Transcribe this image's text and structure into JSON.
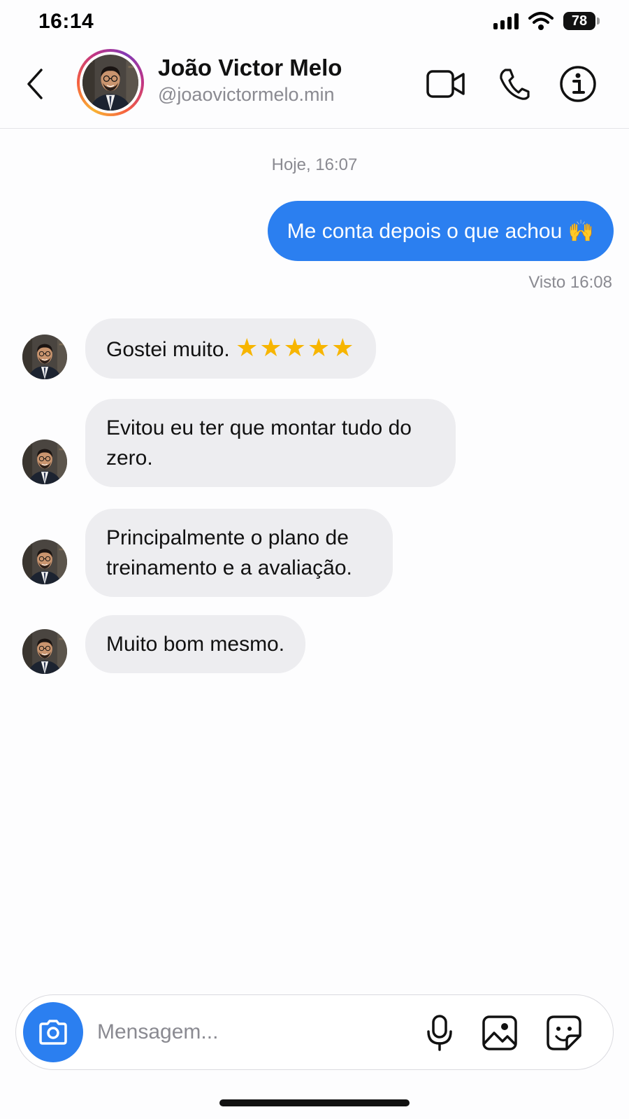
{
  "status_bar": {
    "time": "16:14",
    "battery": "78"
  },
  "header": {
    "contact_name": "João Victor Melo",
    "contact_handle": "@joaovictormelo.min",
    "icons": [
      "back-icon",
      "video-call-icon",
      "phone-icon",
      "info-icon"
    ]
  },
  "conversation": {
    "timestamp": "Hoje, 16:07",
    "outgoing": {
      "text": "Me conta depois o que achou 🙌"
    },
    "seen": "Visto 16:08",
    "incoming": [
      {
        "text": "Gostei muito.",
        "stars": "★★★★★"
      },
      {
        "text": "Evitou eu ter que montar tudo do zero."
      },
      {
        "text": "Principalmente o plano de treinamento e a avaliação."
      },
      {
        "text": "Muito bom mesmo."
      }
    ]
  },
  "composer": {
    "placeholder": "Mensagem...",
    "icons": [
      "camera-icon",
      "microphone-icon",
      "gallery-icon",
      "sticker-icon"
    ]
  },
  "colors": {
    "accent": "#2b7ff0",
    "incoming_bubble": "#ededf0",
    "muted_text": "#8a8a91"
  }
}
